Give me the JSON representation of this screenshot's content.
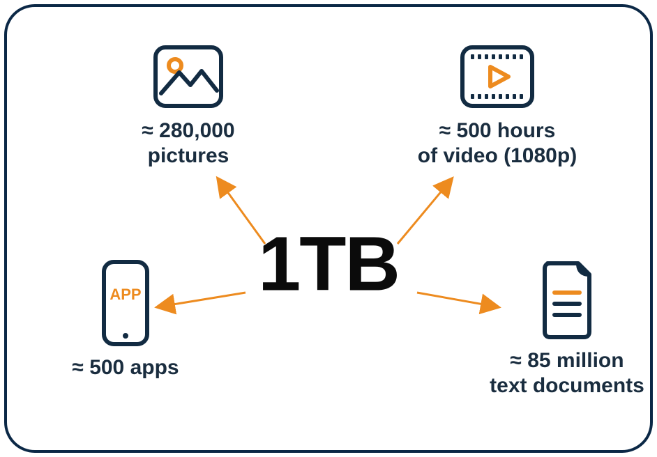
{
  "center": "1TB",
  "items": {
    "pictures": {
      "label": "≈ 280,000\npictures"
    },
    "video": {
      "label": "≈ 500 hours\nof video (1080p)"
    },
    "apps": {
      "label": "≈ 500 apps",
      "icon_text": "APP"
    },
    "documents": {
      "label": "≈ 85 million\ntext documents"
    }
  },
  "colors": {
    "dark": "#122b42",
    "orange": "#ed8b1f"
  }
}
